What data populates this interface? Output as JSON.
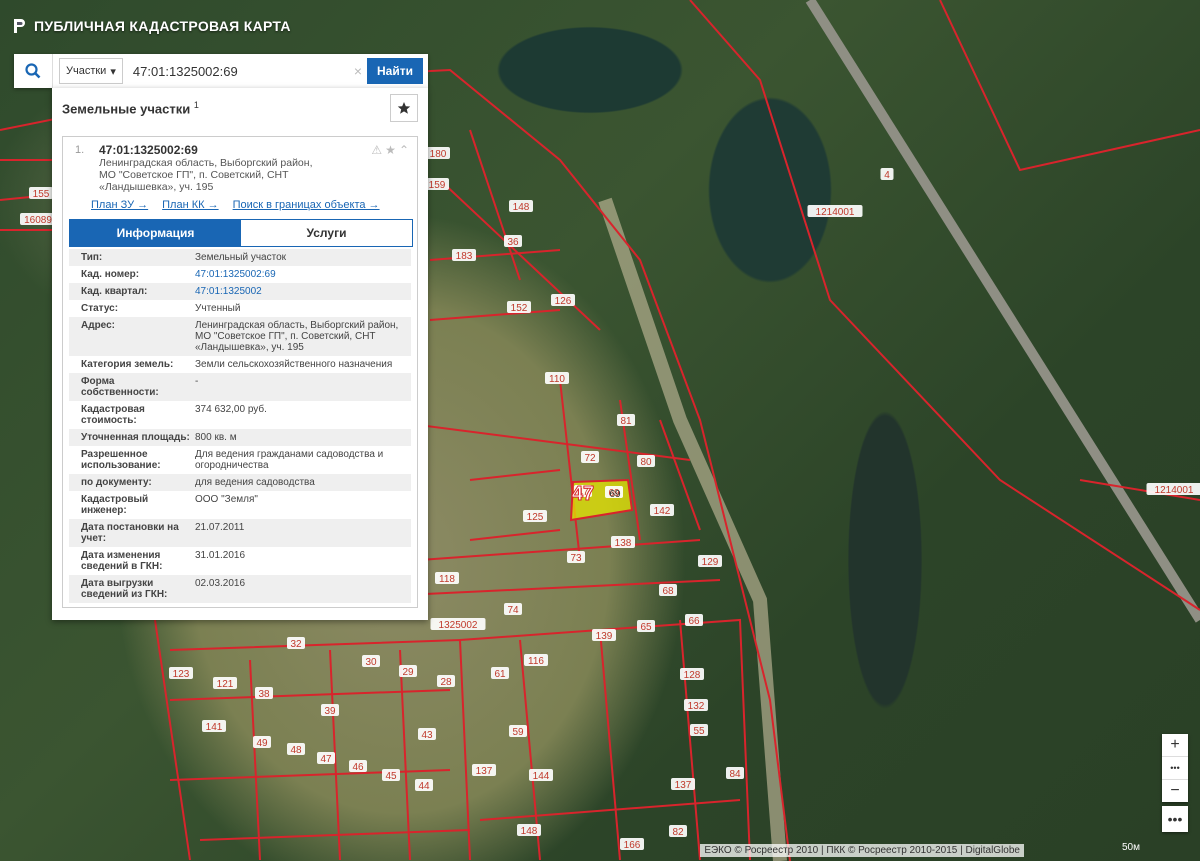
{
  "app": {
    "title": "ПУБЛИЧНАЯ КАДАСТРОВАЯ КАРТА"
  },
  "search": {
    "type_label": "Участки",
    "query": "47:01:1325002:69",
    "button_label": "Найти"
  },
  "results": {
    "title": "Земельные участки",
    "count": "1",
    "items": [
      {
        "number": "1.",
        "cad_id": "47:01:1325002:69",
        "address": "Ленинградская область, Выборгский район, МО \"Советское ГП\", п. Советский, СНТ «Ландышевка», уч. 195",
        "links": [
          "План ЗУ →",
          "План КК →",
          "Поиск в границах объекта →"
        ]
      }
    ],
    "tabs": [
      "Информация",
      "Услуги"
    ],
    "info": [
      {
        "key": "Тип:",
        "value": "Земельный участок"
      },
      {
        "key": "Кад. номер:",
        "value": "47:01:1325002:69"
      },
      {
        "key": "Кад. квартал:",
        "value": "47:01:1325002"
      },
      {
        "key": "Статус:",
        "value": "Учтенный"
      },
      {
        "key": "Адрес:",
        "value": "Ленинградская область, Выборгский район, МО \"Советское ГП\", п. Советский, СНТ «Ландышевка», уч. 195"
      },
      {
        "key": "Категория земель:",
        "value": "Земли сельскохозяйственного назначения"
      },
      {
        "key": "Форма собственности:",
        "value": "-"
      },
      {
        "key": "Кадастровая стоимость:",
        "value": "374 632,00 руб."
      },
      {
        "key": "Уточненная площадь:",
        "value": "800 кв. м"
      },
      {
        "key": "Разрешенное использование:",
        "value": "Для ведения гражданами садоводства и огородничества"
      },
      {
        "key": "по документу:",
        "value": "для ведения садоводства"
      },
      {
        "key": "Кадастровый инженер:",
        "value": "ООО \"Земля\""
      },
      {
        "key": "Дата постановки на учет:",
        "value": "21.07.2011"
      },
      {
        "key": "Дата изменения сведений в ГКН:",
        "value": "31.01.2016"
      },
      {
        "key": "Дата выгрузки сведений из ГКН:",
        "value": "02.03.2016"
      }
    ]
  },
  "map": {
    "labels": [
      "155",
      "16089",
      "180",
      "159",
      "148",
      "36",
      "183",
      "126",
      "152",
      "110",
      "81",
      "72",
      "80",
      "47",
      "69",
      "142",
      "125",
      "138",
      "73",
      "129",
      "118",
      "74",
      "68",
      "139",
      "65",
      "66",
      "1325002",
      "32",
      "30",
      "29",
      "28",
      "61",
      "116",
      "128",
      "123",
      "121",
      "38",
      "39",
      "141",
      "49",
      "48",
      "47",
      "46",
      "45",
      "43",
      "44",
      "59",
      "132",
      "55",
      "137",
      "144",
      "137",
      "84",
      "148",
      "82",
      "166",
      "4",
      "1214001",
      "1214001"
    ],
    "highlight_label": "69",
    "block_label": "47",
    "colors": {
      "boundary": "#d8242c",
      "highlight": "#e6e600",
      "accent": "#1966b4"
    }
  },
  "copyright": "ЕЭКО © Росреестр 2010 | ПКК © Росреестр 2010-2015 | DigitalGlobe",
  "scale_label": "50м",
  "controls": {
    "zoom_in": "+",
    "zoom_out": "−",
    "more": "•••"
  }
}
